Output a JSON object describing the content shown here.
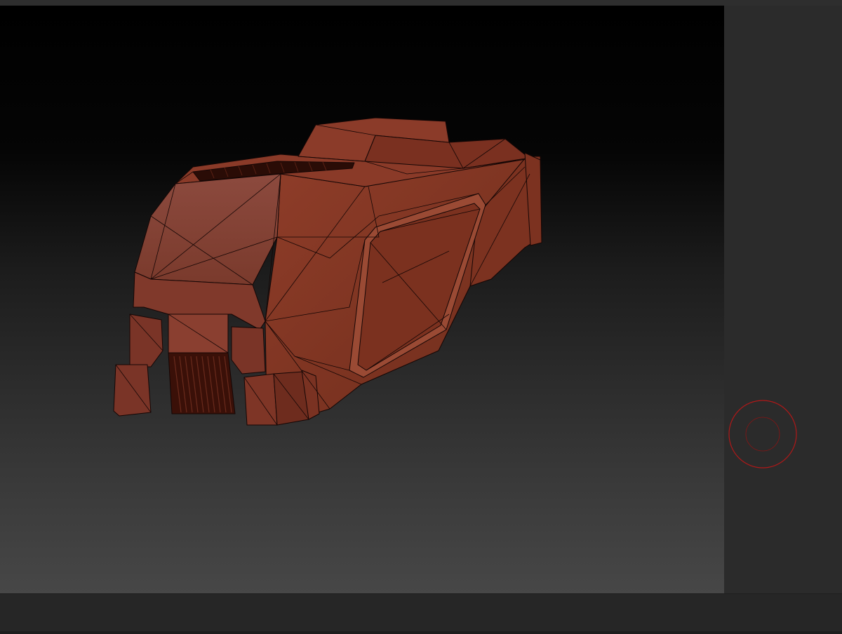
{
  "app": {
    "accent_color": "#b01818"
  },
  "viewport": {
    "model": {
      "fill_color": "#8a3a28",
      "wire_color": "#140605",
      "highlight_color": "#a04a36"
    }
  },
  "brush_cursor": {
    "icon": "draw-size-circle-icon",
    "color": "#b01818"
  }
}
